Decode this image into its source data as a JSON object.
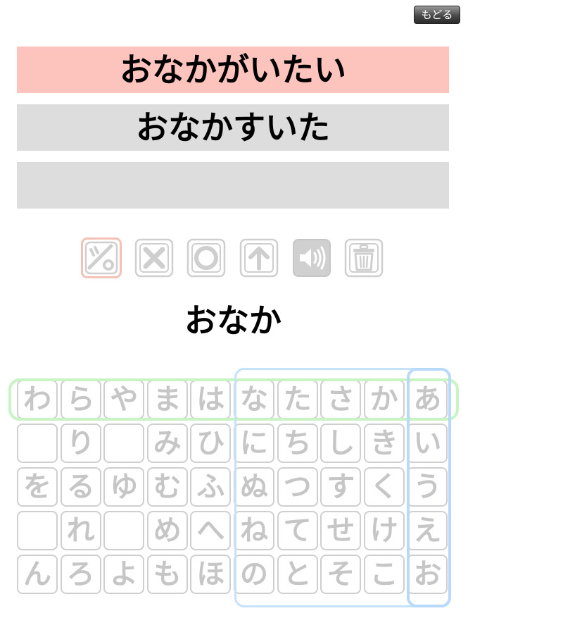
{
  "header": {
    "back_label": "もどる"
  },
  "candidates": [
    "おなかがいたい",
    "おなかすいた",
    ""
  ],
  "tools": [
    {
      "name": "dakuten-icon",
      "active": true
    },
    {
      "name": "close-icon"
    },
    {
      "name": "circle-icon"
    },
    {
      "name": "arrow-up-icon"
    },
    {
      "name": "speaker-icon"
    },
    {
      "name": "trash-icon"
    }
  ],
  "input_text": "おなか",
  "keyboard": {
    "rows": [
      [
        "わ",
        "ら",
        "や",
        "ま",
        "は",
        "な",
        "た",
        "さ",
        "か",
        "あ"
      ],
      [
        "",
        "り",
        "",
        "み",
        "ひ",
        "に",
        "ち",
        "し",
        "き",
        "い"
      ],
      [
        "を",
        "る",
        "ゆ",
        "む",
        "ふ",
        "ぬ",
        "つ",
        "す",
        "く",
        "う"
      ],
      [
        "",
        "れ",
        "",
        "め",
        "へ",
        "ね",
        "て",
        "せ",
        "け",
        "え"
      ],
      [
        "ん",
        "ろ",
        "よ",
        "も",
        "ほ",
        "の",
        "と",
        "そ",
        "こ",
        "お"
      ]
    ]
  },
  "colors": {
    "selected_candidate": "#fdc4be",
    "candidate": "#dddddd",
    "key_text": "#c6c6c6",
    "row_highlight": "#c8f4c4",
    "column_highlight": "#b8dafa"
  }
}
